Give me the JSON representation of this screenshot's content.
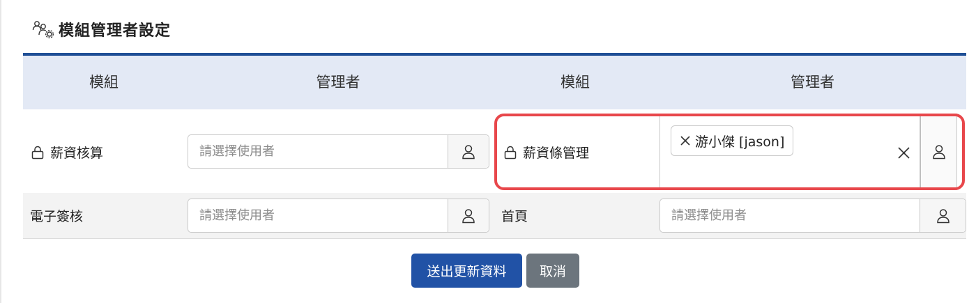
{
  "page": {
    "title": "模組管理者設定",
    "title_icon": "users-gear-icon"
  },
  "table": {
    "headers": [
      "模組",
      "管理者",
      "模組",
      "管理者"
    ],
    "rows": [
      {
        "left": {
          "module": "薪資核算",
          "locked": true,
          "placeholder": "請選擇使用者"
        },
        "right": {
          "module": "薪資條管理",
          "locked": true,
          "selected_users": [
            "游小傑 [jason]"
          ]
        }
      },
      {
        "left": {
          "module": "電子簽核",
          "locked": false,
          "placeholder": "請選擇使用者"
        },
        "right": {
          "module": "首頁",
          "locked": false,
          "placeholder": "請選擇使用者"
        }
      }
    ]
  },
  "actions": {
    "submit_label": "送出更新資料",
    "cancel_label": "取消"
  },
  "colors": {
    "header_line": "#1f4f96",
    "header_bg": "#e3e9f5",
    "primary": "#2152a6",
    "secondary": "#6c757d",
    "highlight": "#e8474b"
  }
}
